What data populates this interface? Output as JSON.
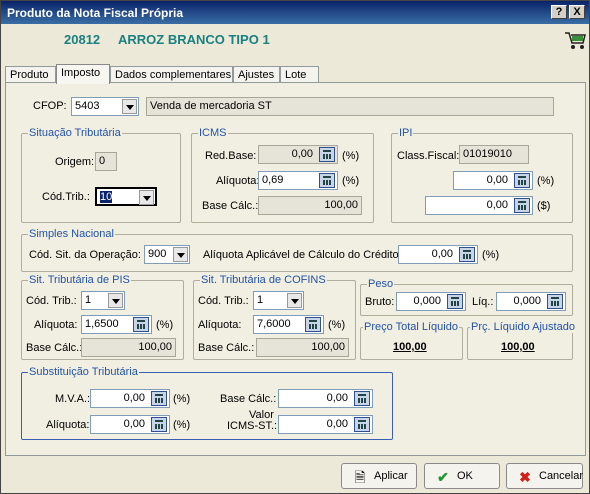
{
  "window": {
    "title": "Produto da Nota Fiscal Própria",
    "help_label": "?",
    "close_label": "X"
  },
  "product": {
    "code": "20812",
    "name": "ARROZ BRANCO TIPO 1"
  },
  "tabs": [
    "Produto",
    "Imposto",
    "Dados complementares",
    "Ajustes",
    "Lote"
  ],
  "cfop": {
    "label": "CFOP:",
    "value": "5403",
    "description": "Venda de mercadoria ST"
  },
  "situacao": {
    "legend": "Situação Tributária",
    "origem_label": "Origem:",
    "origem_value": "0",
    "cod_label": "Cód.Trib.:",
    "cod_value": "10"
  },
  "icms": {
    "legend": "ICMS",
    "redbase_label": "Red.Base:",
    "redbase_value": "0,00",
    "aliquota_label": "Alíquota:",
    "aliquota_value": "0,69",
    "basecalc_label": "Base Cálc.:",
    "basecalc_value": "100,00",
    "pct": "(%)"
  },
  "ipi": {
    "legend": "IPI",
    "classfiscal_label": "Class.Fiscal:",
    "classfiscal_value": "01019010",
    "v1": "0,00",
    "v2": "0,00",
    "pct": "(%)",
    "money": "($)"
  },
  "simples": {
    "legend": "Simples Nacional",
    "cod_label": "Cód. Sit. da Operação:",
    "cod_value": "900",
    "aliq_label": "Alíquota Aplicável de Cálculo do Crédito:",
    "aliq_value": "0,00",
    "pct": "(%)"
  },
  "pis": {
    "legend": "Sit. Tributária de PIS",
    "cod_label": "Cód. Trib.:",
    "cod_value": "1",
    "aliq_label": "Alíquota:",
    "aliq_value": "1,6500",
    "base_label": "Base Cálc.:",
    "base_value": "100,00",
    "pct": "(%)"
  },
  "cofins": {
    "legend": "Sit. Tributária de COFINS",
    "cod_label": "Cód. Trib.:",
    "cod_value": "1",
    "aliq_label": "Alíquota:",
    "aliq_value": "7,6000",
    "base_label": "Base Cálc.:",
    "base_value": "100,00",
    "pct": "(%)"
  },
  "peso": {
    "legend": "Peso",
    "bruto_label": "Bruto:",
    "bruto_value": "0,000",
    "liq_label": "Líq.:",
    "liq_value": "0,000"
  },
  "preco_total": {
    "legend": "Preço Total Líquido",
    "value": "100,00"
  },
  "preco_ajustado": {
    "legend": "Prç. Líquido Ajustado",
    "value": "100,00"
  },
  "st": {
    "legend": "Substituição Tributária",
    "mva_label": "M.V.A.:",
    "mva_value": "0,00",
    "aliq_label": "Alíquota:",
    "aliq_value": "0,00",
    "base_label": "Base Cálc.:",
    "base_value": "0,00",
    "valor_label1": "Valor",
    "valor_label2": "ICMS-ST.:",
    "valor_value": "0,00",
    "pct": "(%)"
  },
  "buttons": {
    "apply": "Aplicar",
    "ok": "OK",
    "cancel": "Cancelar"
  },
  "colors": {
    "title_bar": "#0a246a",
    "header_text": "#1a8080",
    "legend": "#2352a8"
  }
}
